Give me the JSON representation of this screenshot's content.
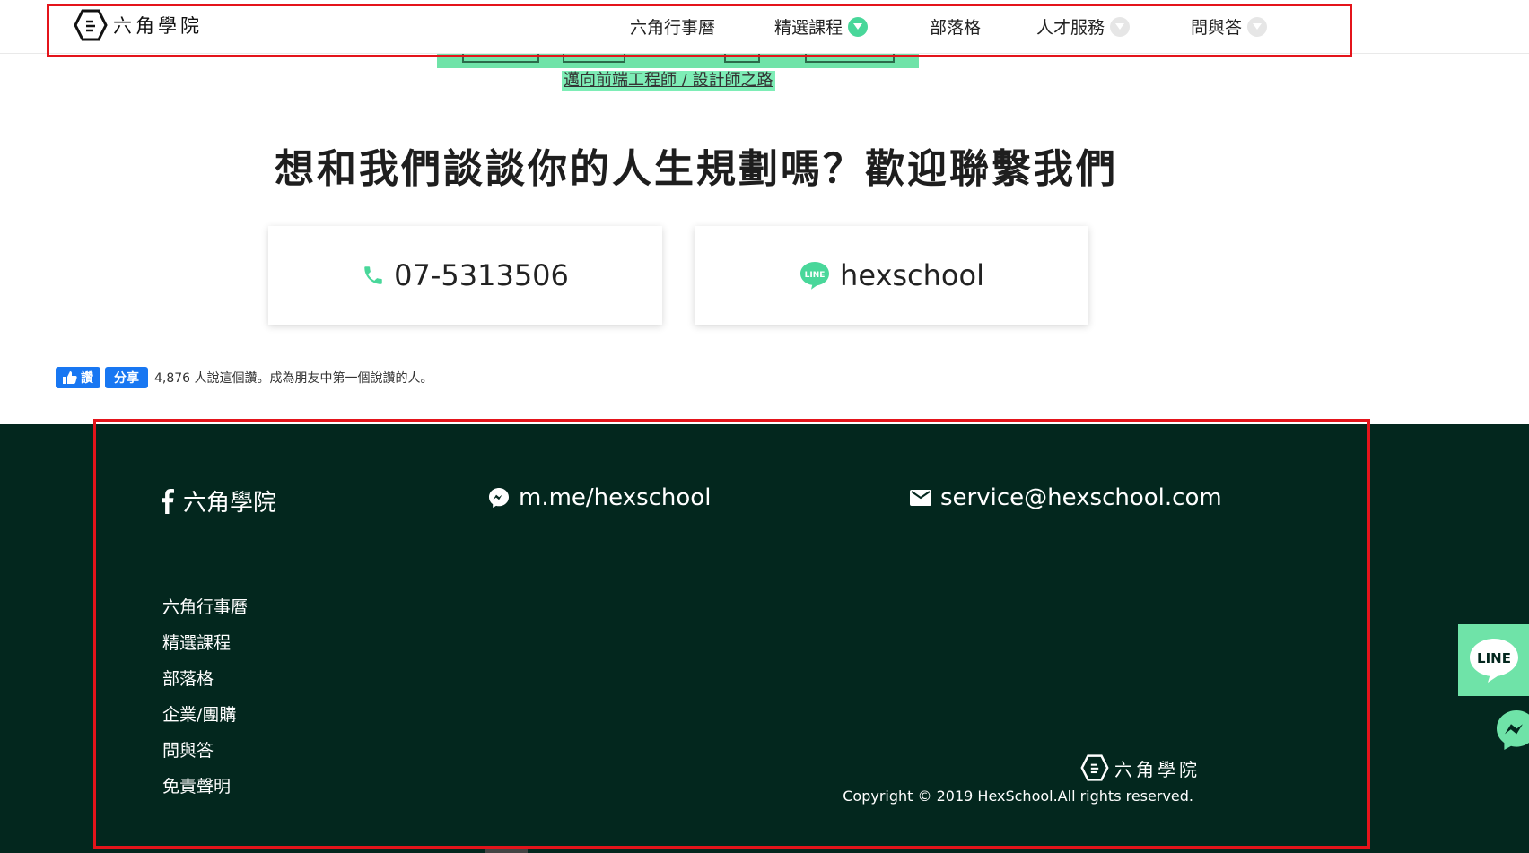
{
  "brand": {
    "name": "六角學院",
    "colors": {
      "accent": "#49d79a",
      "footer_bg": "#03271e",
      "highlight": "#e4141b",
      "facebook": "#1877f2"
    }
  },
  "nav": {
    "items": [
      {
        "label": "六角行事曆",
        "dropdown": "none"
      },
      {
        "label": "精選課程",
        "dropdown": "green",
        "icon": "chevron-down-icon"
      },
      {
        "label": "部落格",
        "dropdown": "none"
      },
      {
        "label": "人才服務",
        "dropdown": "gray",
        "icon": "chevron-down-icon"
      },
      {
        "label": "問與答",
        "dropdown": "gray",
        "icon": "chevron-down-icon"
      }
    ]
  },
  "banner": {
    "caption": "邁向前端工程師 / 設計師之路"
  },
  "contact": {
    "headline": "想和我們談談你的人生規劃嗎？歡迎聯繫我們",
    "phone": {
      "icon": "phone-icon",
      "label": "07-5313506"
    },
    "line": {
      "icon": "line-icon",
      "label": "hexschool"
    }
  },
  "facebook": {
    "like_label": "讚",
    "share_label": "分享",
    "summary": "4,876 人說這個讚。成為朋友中第一個說讚的人。"
  },
  "footer": {
    "facebook": {
      "icon": "facebook-icon",
      "label": "六角學院"
    },
    "messenger": {
      "icon": "messenger-icon",
      "label": "m.me/hexschool"
    },
    "email": {
      "icon": "mail-icon",
      "label": "service@hexschool.com"
    },
    "menu": [
      "六角行事曆",
      "精選課程",
      "部落格",
      "企業/團購",
      "問與答",
      "免責聲明"
    ],
    "brand_name": "六角學院",
    "copyright": "Copyright © 2019 HexSchool.All rights reserved."
  },
  "floating": {
    "line_label": "LINE",
    "messenger_icon": "messenger-icon"
  }
}
